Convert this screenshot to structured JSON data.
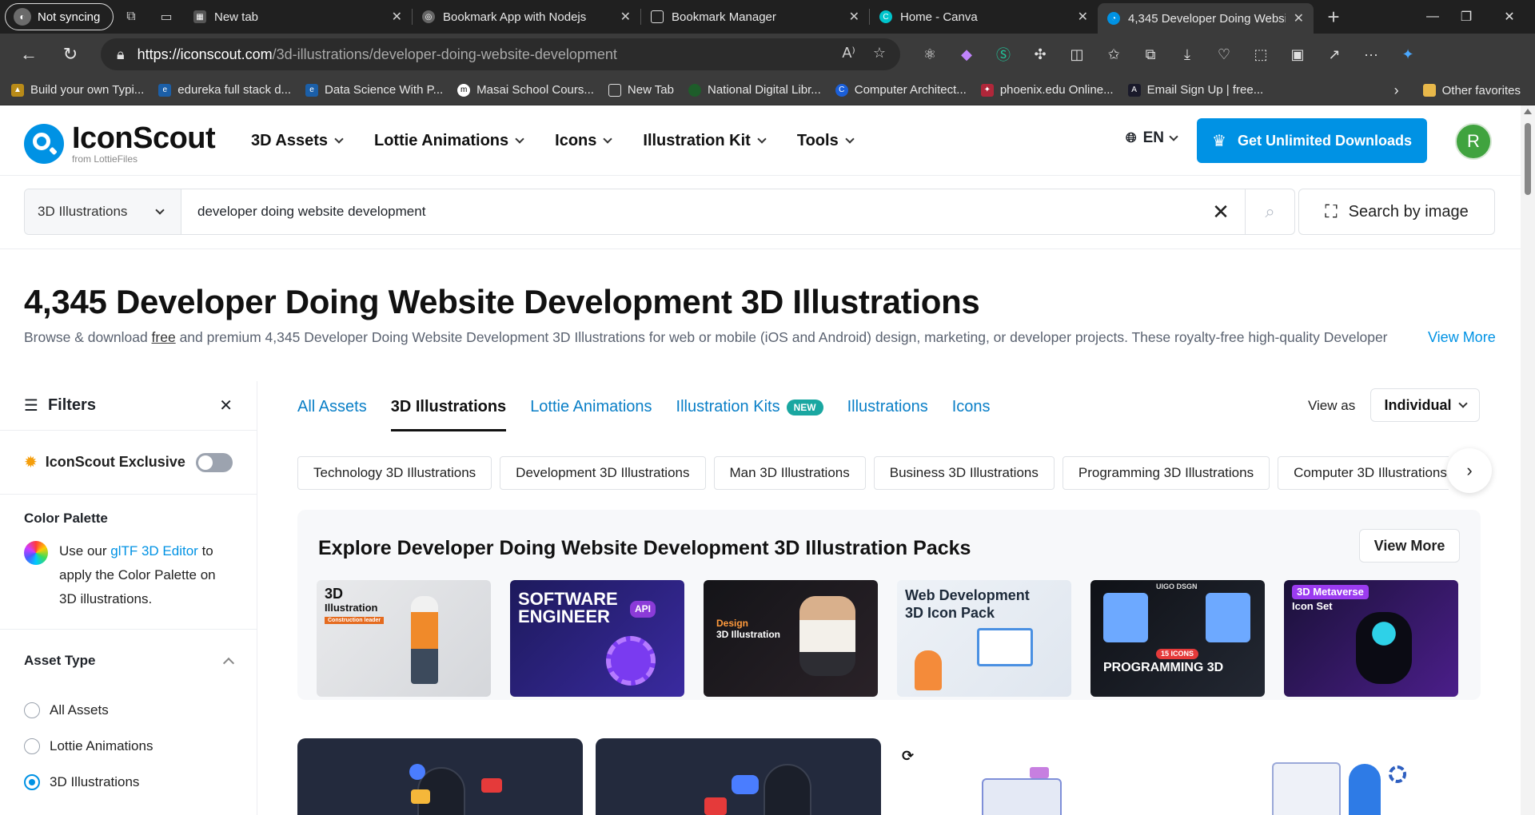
{
  "browser": {
    "profile_label": "Not syncing",
    "tabs": [
      {
        "title": "New tab",
        "active": false
      },
      {
        "title": "Bookmark App with Nodejs",
        "active": false
      },
      {
        "title": "Bookmark Manager",
        "active": false
      },
      {
        "title": "Home - Canva",
        "active": false
      },
      {
        "title": "4,345 Developer Doing Websit",
        "active": true
      }
    ],
    "url_host": "https://iconscout.com",
    "url_path": "/3d-illustrations/developer-doing-website-development",
    "bookmarks": [
      "Build your own Typi...",
      "edureka full stack d...",
      "Data Science With P...",
      "Masai School Cours...",
      "New Tab",
      "National Digital Libr...",
      "Computer Architect...",
      "phoenix.edu Online...",
      "Email Sign Up | free..."
    ],
    "other_favorites": "Other favorites"
  },
  "header": {
    "logo_name": "IconScout",
    "logo_sub": "from LottieFiles",
    "nav": [
      "3D Assets",
      "Lottie Animations",
      "Icons",
      "Illustration Kit",
      "Tools"
    ],
    "lang": "EN",
    "cta": "Get Unlimited Downloads",
    "avatar_initial": "R"
  },
  "search": {
    "category": "3D Illustrations",
    "query": "developer doing website development",
    "by_image": "Search by image"
  },
  "page": {
    "title": "4,345 Developer Doing Website Development 3D Illustrations",
    "desc_before": "Browse & download ",
    "desc_free": "free",
    "desc_after": " and premium 4,345 Developer Doing Website Development 3D Illustrations for web or mobile (iOS and Android) design, marketing, or developer projects. These royalty-free high-quality Developer",
    "view_more": "View More"
  },
  "sidebar": {
    "filters": "Filters",
    "exclusive": "IconScout Exclusive",
    "exclusive_on": false,
    "color_palette_title": "Color Palette",
    "palette_text_1": "Use our ",
    "palette_link": "glTF 3D Editor",
    "palette_text_2": " to apply the Color Palette on 3D illustrations.",
    "asset_type_title": "Asset Type",
    "asset_types": [
      {
        "label": "All Assets",
        "selected": false
      },
      {
        "label": "Lottie Animations",
        "selected": false
      },
      {
        "label": "3D Illustrations",
        "selected": true
      }
    ]
  },
  "main": {
    "tabs": [
      {
        "label": "All Assets",
        "active": false
      },
      {
        "label": "3D Illustrations",
        "active": true
      },
      {
        "label": "Lottie Animations",
        "active": false
      },
      {
        "label": "Illustration Kits",
        "active": false,
        "badge": "NEW"
      },
      {
        "label": "Illustrations",
        "active": false
      },
      {
        "label": "Icons",
        "active": false
      }
    ],
    "view_as_label": "View as",
    "view_as_value": "Individual",
    "chips": [
      "Technology 3D Illustrations",
      "Development 3D Illustrations",
      "Man 3D Illustrations",
      "Business 3D Illustrations",
      "Programming 3D Illustrations",
      "Computer 3D Illustrations"
    ],
    "packs_title": "Explore Developer Doing Website Development 3D Illustration Packs",
    "packs_view_more": "View More",
    "packs": [
      {
        "line1": "3D",
        "line2": "Illustration",
        "tag": "Construction leader"
      },
      {
        "line1": "SOFTWARE",
        "line2": "ENGINEER",
        "tag": "API"
      },
      {
        "line1": "Design",
        "line2": "3D Illustration",
        "tag": ""
      },
      {
        "line1": "Web Development",
        "line2": "3D Icon Pack",
        "tag": ""
      },
      {
        "line1": "PROGRAMMING 3D",
        "line2": "15 ICONS",
        "tag": "UIGO DSGN"
      },
      {
        "line1": "3D Metaverse",
        "line2": "Icon Set",
        "tag": ""
      }
    ]
  },
  "colors": {
    "brand": "#0092e4",
    "browser_dark": "#202020",
    "toolbar": "#3b3b3b"
  }
}
